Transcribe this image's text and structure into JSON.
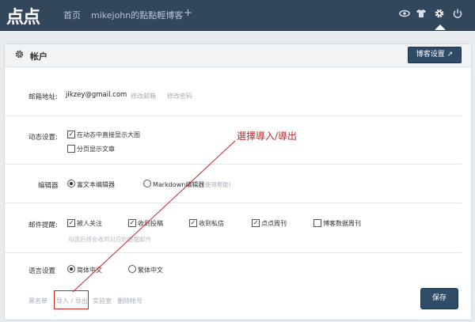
{
  "topbar": {
    "logo": "点点",
    "nav": [
      "首页",
      "mikejohn的點點輕博客",
      "+"
    ],
    "icons": [
      "eye-icon",
      "tshirt-icon",
      "gear-icon",
      "power-icon"
    ]
  },
  "panel": {
    "title": "帐户",
    "blog_settings_button": "博客设置 ↗"
  },
  "email_row": {
    "label": "邮箱地址:",
    "value": "jikzey@gmail.com",
    "change_email": "修改邮箱",
    "change_password": "修改密码"
  },
  "dynamic_row": {
    "label": "动态设置:",
    "options": [
      {
        "label": "在动态中直接显示大图",
        "checked": true
      },
      {
        "label": "分页显示文章",
        "checked": false
      }
    ]
  },
  "editor_row": {
    "label": "编辑器",
    "options": [
      {
        "label": "富文本编辑器",
        "selected": true
      },
      {
        "label": "Markdown编辑器",
        "selected": false
      }
    ],
    "help": "(使用帮助)"
  },
  "mail_row": {
    "label": "邮件提醒:",
    "options": [
      {
        "label": "被人关注",
        "checked": true
      },
      {
        "label": "收到投稿",
        "checked": true
      },
      {
        "label": "收到私信",
        "checked": true
      },
      {
        "label": "点点周刊",
        "checked": true
      },
      {
        "label": "博客数据周刊",
        "checked": false
      }
    ],
    "hint": "勾选后将会收到对应的提醒邮件"
  },
  "language_row": {
    "label": "语言设置",
    "options": [
      {
        "label": "简体中文",
        "selected": true
      },
      {
        "label": "繁体中文",
        "selected": false
      }
    ]
  },
  "bottom_links": [
    "黑名单",
    "导入 / 导出",
    "实验室",
    "删除帐号"
  ],
  "save_button": "保存",
  "annotation": "選擇導入/導出",
  "colors": {
    "topbar": "#33475c",
    "accent_button": "#2f4c69",
    "annotation": "#c0272d"
  }
}
